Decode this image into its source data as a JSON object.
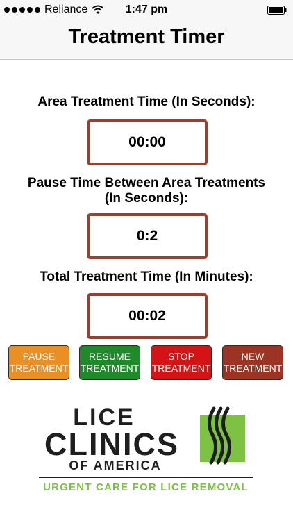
{
  "status_bar": {
    "carrier": "Reliance",
    "time": "1:47 pm"
  },
  "nav": {
    "title": "Treatment Timer"
  },
  "fields": [
    {
      "label": "Area Treatment Time (In Seconds):",
      "value": "00:00"
    },
    {
      "label_line1": "Pause Time Between Area Treatments",
      "label_line2": "(In Seconds):",
      "value": "0:2"
    },
    {
      "label": "Total Treatment Time (In Minutes):",
      "value": "00:02"
    }
  ],
  "buttons": [
    {
      "line1": "PAUSE",
      "line2": "TREATMENT",
      "color": "#e98f24"
    },
    {
      "line1": "RESUME",
      "line2": "TREATMENT",
      "color": "#1f8a2a"
    },
    {
      "line1": "STOP",
      "line2": "TREATMENT",
      "color": "#d41414"
    },
    {
      "line1": "NEW",
      "line2": "TREATMENT",
      "color": "#9b3422"
    }
  ],
  "logo": {
    "line1": "LICE",
    "line2": "CLINICS",
    "line3": "OF AMERICA",
    "tagline": "URGENT CARE FOR LICE REMOVAL"
  },
  "colors": {
    "box_border": "#9b3e2d",
    "logo_green": "#7dc243",
    "logo_dark": "#1e1e1e"
  }
}
